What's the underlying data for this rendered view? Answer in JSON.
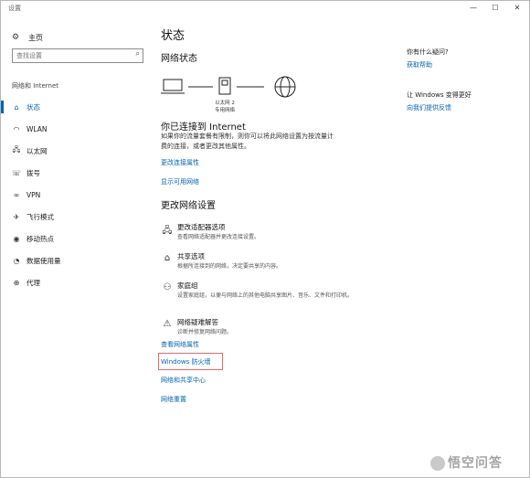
{
  "window": {
    "title": "设置",
    "controls": {
      "minimize": "—",
      "maximize": "☐",
      "close": "✕"
    }
  },
  "sidebar": {
    "home_label": "主页",
    "search_placeholder": "查找设置",
    "section_label": "网络和 Internet",
    "items": [
      {
        "label": "状态",
        "icon": "home-status-icon",
        "glyph": "⌂",
        "active": true
      },
      {
        "label": "WLAN",
        "icon": "wifi-icon",
        "glyph": "◠"
      },
      {
        "label": "以太网",
        "icon": "ethernet-icon",
        "glyph": "🖧"
      },
      {
        "label": "拨号",
        "icon": "phone-icon",
        "glyph": "☏"
      },
      {
        "label": "VPN",
        "icon": "vpn-icon",
        "glyph": "∞"
      },
      {
        "label": "飞行模式",
        "icon": "airplane-icon",
        "glyph": "✈"
      },
      {
        "label": "移动热点",
        "icon": "hotspot-icon",
        "glyph": "◉"
      },
      {
        "label": "数据使用量",
        "icon": "data-usage-icon",
        "glyph": "◔"
      },
      {
        "label": "代理",
        "icon": "globe-icon",
        "glyph": "⊕"
      }
    ]
  },
  "main": {
    "title": "状态",
    "network_status_heading": "网络状态",
    "diagram_label_line1": "以太网 2",
    "diagram_label_line2": "专用网络",
    "connected_heading": "你已连接到 Internet",
    "connected_desc_line1": "如果你的流量套餐有限制，则你可以将此网络设置为按流量计",
    "connected_desc_line2": "费的连接，或者更改其他属性。",
    "link_change_props": "更改连接属性",
    "link_show_networks": "显示可用网络",
    "change_settings_heading": "更改网络设置",
    "options": [
      {
        "title": "更改适配器选项",
        "desc": "查看网络适配器并更改连接设置。",
        "icon": "adapter-icon",
        "glyph": "🖧"
      },
      {
        "title": "共享选项",
        "desc": "根据所连接到的网络，决定要共享的内容。",
        "icon": "sharing-icon",
        "glyph": "⌂"
      },
      {
        "title": "家庭组",
        "desc": "设置家庭组，以便与网络上的其他电脑共享图片、音乐、文件和打印机。",
        "icon": "homegroup-icon",
        "glyph": "⚇"
      },
      {
        "title": "网络疑难解答",
        "desc": "诊断并修复网络问题。",
        "icon": "warning-icon",
        "glyph": "⚠"
      }
    ],
    "link_view_props": "查看网络属性",
    "link_firewall": "Windows 防火墙",
    "link_sharing_center": "网络和共享中心",
    "link_reset": "网络重置"
  },
  "right": {
    "q1": "你有什么疑问?",
    "q1_link": "获取帮助",
    "q2": "让 Windows 变得更好",
    "q2_link": "向我们提供反馈"
  },
  "watermark": "悟空问答"
}
